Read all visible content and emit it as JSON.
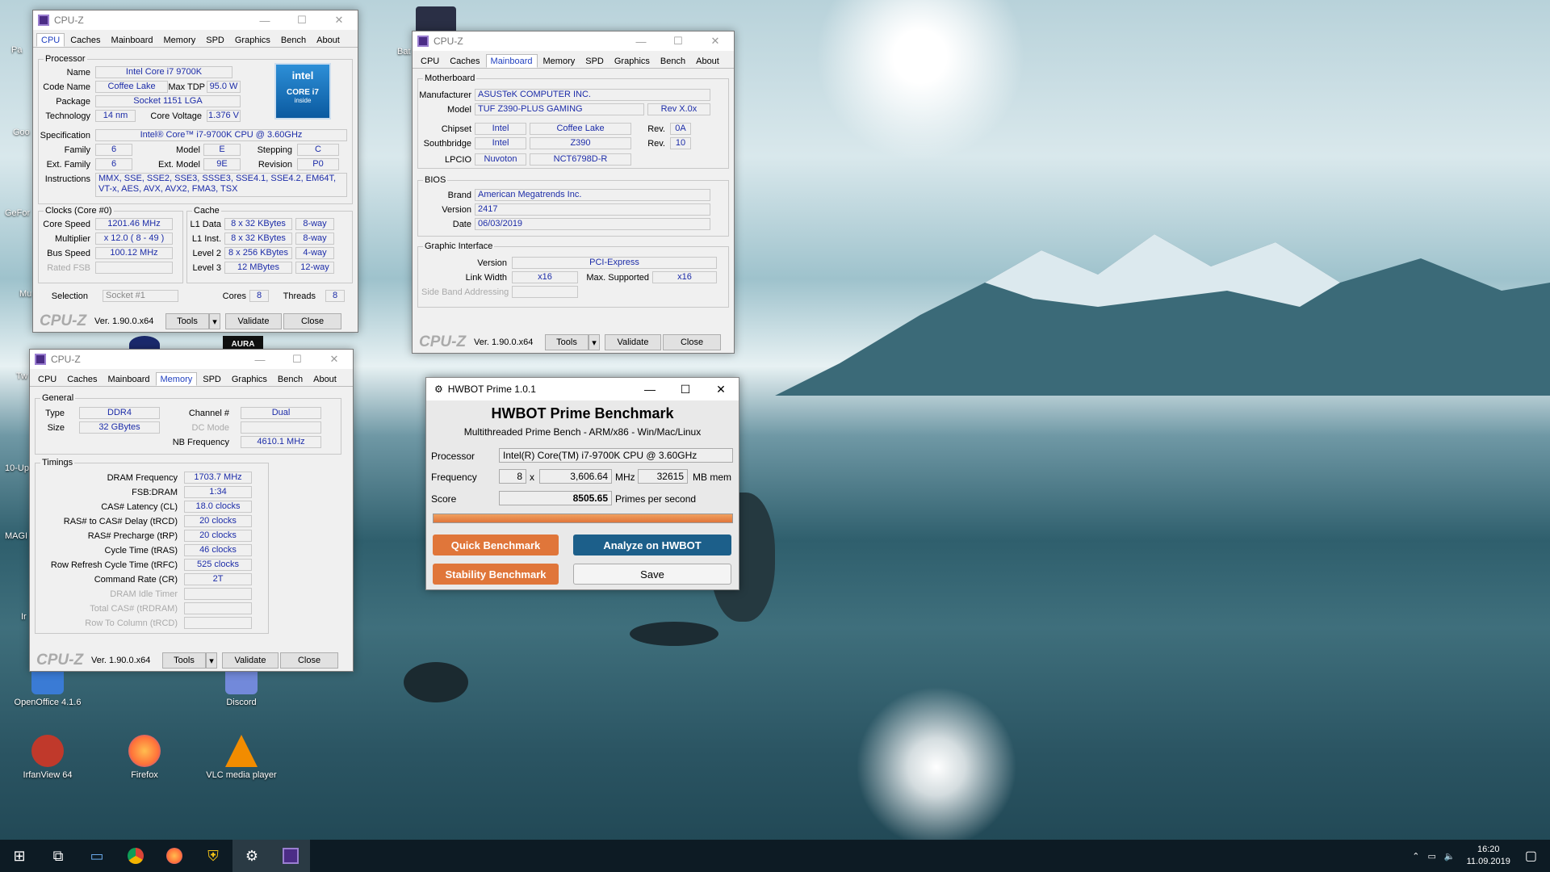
{
  "desktop": {
    "icons": [
      {
        "label": "OpenOffice 4.1.6",
        "color": "#3a7bd5"
      },
      {
        "label": "Discord",
        "color": "#7289da"
      },
      {
        "label": "IrfanView 64",
        "color": "#c0392b"
      },
      {
        "label": "Firefox",
        "color": "#ff7139"
      },
      {
        "label": "VLC media player",
        "color": "#f28c00"
      }
    ],
    "partial_labels": [
      "Pa",
      "Goo",
      "GeFor",
      "Mu",
      "Tw",
      "10-Up",
      "MAGI",
      "Ir",
      "Bat"
    ]
  },
  "cpuz_cpu": {
    "title": "CPU-Z",
    "tabs": [
      "CPU",
      "Caches",
      "Mainboard",
      "Memory",
      "SPD",
      "Graphics",
      "Bench",
      "About"
    ],
    "processor_label": "Processor",
    "name_label": "Name",
    "name": "Intel Core i7 9700K",
    "codename_label": "Code Name",
    "codename": "Coffee Lake",
    "maxtdp_label": "Max TDP",
    "maxtdp": "95.0 W",
    "package_label": "Package",
    "package": "Socket 1151 LGA",
    "tech_label": "Technology",
    "tech": "14 nm",
    "corevolt_label": "Core Voltage",
    "corevolt": "1.376 V",
    "spec_label": "Specification",
    "spec": "Intel® Core™ i7-9700K CPU @ 3.60GHz",
    "family_label": "Family",
    "family": "6",
    "model_label": "Model",
    "model": "E",
    "stepping_label": "Stepping",
    "stepping": "C",
    "extfamily_label": "Ext. Family",
    "extfamily": "6",
    "extmodel_label": "Ext. Model",
    "extmodel": "9E",
    "revision_label": "Revision",
    "revision": "P0",
    "instr_label": "Instructions",
    "instr": "MMX, SSE, SSE2, SSE3, SSSE3, SSE4.1, SSE4.2, EM64T, VT-x, AES, AVX, AVX2, FMA3, TSX",
    "intel_logo": "intel",
    "intel_core": "CORE i7",
    "intel_inside": "inside",
    "clocks_label": "Clocks (Core #0)",
    "corespeed_label": "Core Speed",
    "corespeed": "1201.46 MHz",
    "mult_label": "Multiplier",
    "mult": "x 12.0 ( 8 - 49 )",
    "bus_label": "Bus Speed",
    "bus": "100.12 MHz",
    "fsb_label": "Rated FSB",
    "cache_label": "Cache",
    "l1d_label": "L1 Data",
    "l1d": "8 x 32 KBytes",
    "l1d_way": "8-way",
    "l1i_label": "L1 Inst.",
    "l1i": "8 x 32 KBytes",
    "l1i_way": "8-way",
    "l2_label": "Level 2",
    "l2": "8 x 256 KBytes",
    "l2_way": "4-way",
    "l3_label": "Level 3",
    "l3": "12 MBytes",
    "l3_way": "12-way",
    "sel_label": "Selection",
    "sel": "Socket #1",
    "cores_label": "Cores",
    "cores": "8",
    "threads_label": "Threads",
    "threads": "8",
    "logo": "CPU-Z",
    "ver": "Ver. 1.90.0.x64",
    "tools": "Tools",
    "validate": "Validate",
    "close": "Close"
  },
  "cpuz_mb": {
    "title": "CPU-Z",
    "tabs": [
      "CPU",
      "Caches",
      "Mainboard",
      "Memory",
      "SPD",
      "Graphics",
      "Bench",
      "About"
    ],
    "mb_label": "Motherboard",
    "manu_label": "Manufacturer",
    "manu": "ASUSTeK COMPUTER INC.",
    "model_label": "Model",
    "model": "TUF Z390-PLUS GAMING",
    "rev": "Rev X.0x",
    "chipset_label": "Chipset",
    "chipset_v": "Intel",
    "chipset_n": "Coffee Lake",
    "chipset_rev_label": "Rev.",
    "chipset_rev": "0A",
    "sb_label": "Southbridge",
    "sb_v": "Intel",
    "sb_n": "Z390",
    "sb_rev_label": "Rev.",
    "sb_rev": "10",
    "lpcio_label": "LPCIO",
    "lpcio_v": "Nuvoton",
    "lpcio_n": "NCT6798D-R",
    "bios_label": "BIOS",
    "brand_label": "Brand",
    "brand": "American Megatrends Inc.",
    "version_label": "Version",
    "version": "2417",
    "date_label": "Date",
    "date": "06/03/2019",
    "gi_label": "Graphic Interface",
    "giver_label": "Version",
    "giver": "PCI-Express",
    "lw_label": "Link Width",
    "lw": "x16",
    "ms_label": "Max. Supported",
    "ms": "x16",
    "sba_label": "Side Band Addressing",
    "logo": "CPU-Z",
    "ver": "Ver. 1.90.0.x64",
    "tools": "Tools",
    "validate": "Validate",
    "close": "Close"
  },
  "cpuz_mem": {
    "title": "CPU-Z",
    "tabs": [
      "CPU",
      "Caches",
      "Mainboard",
      "Memory",
      "SPD",
      "Graphics",
      "Bench",
      "About"
    ],
    "general_label": "General",
    "type_label": "Type",
    "type": "DDR4",
    "size_label": "Size",
    "size": "32 GBytes",
    "chan_label": "Channel #",
    "chan": "Dual",
    "dc_label": "DC Mode",
    "nb_label": "NB Frequency",
    "nb": "4610.1 MHz",
    "timings_label": "Timings",
    "timings": [
      {
        "label": "DRAM Frequency",
        "value": "1703.7 MHz"
      },
      {
        "label": "FSB:DRAM",
        "value": "1:34"
      },
      {
        "label": "CAS# Latency (CL)",
        "value": "18.0 clocks"
      },
      {
        "label": "RAS# to CAS# Delay (tRCD)",
        "value": "20 clocks"
      },
      {
        "label": "RAS# Precharge (tRP)",
        "value": "20 clocks"
      },
      {
        "label": "Cycle Time (tRAS)",
        "value": "46 clocks"
      },
      {
        "label": "Row Refresh Cycle Time (tRFC)",
        "value": "525 clocks"
      },
      {
        "label": "Command Rate (CR)",
        "value": "2T"
      },
      {
        "label": "DRAM Idle Timer",
        "value": ""
      },
      {
        "label": "Total CAS# (tRDRAM)",
        "value": ""
      },
      {
        "label": "Row To Column (tRCD)",
        "value": ""
      }
    ],
    "logo": "CPU-Z",
    "ver": "Ver. 1.90.0.x64",
    "tools": "Tools",
    "validate": "Validate",
    "close": "Close"
  },
  "hwbot": {
    "title": "HWBOT Prime 1.0.1",
    "heading": "HWBOT Prime Benchmark",
    "sub": "Multithreaded Prime Bench - ARM/x86 - Win/Mac/Linux",
    "proc_label": "Processor",
    "proc": "Intel(R) Core(TM) i7-9700K CPU @ 3.60GHz",
    "freq_label": "Frequency",
    "threads": "8",
    "x": "x",
    "freq": "3,606.64",
    "mhz": "MHz",
    "mem": "32615",
    "mbmem": "MB mem",
    "score_label": "Score",
    "score": "8505.65",
    "pps": "Primes per second",
    "progress": 1.0,
    "quick": "Quick Benchmark",
    "analyze": "Analyze on HWBOT",
    "stability": "Stability Benchmark",
    "save": "Save"
  },
  "taskbar": {
    "time": "16:20",
    "date": "11.09.2019"
  },
  "colors": {
    "accent": "#1c2ca8",
    "hw_orange": "#e0763a",
    "hw_blue": "#1c5f8a"
  }
}
